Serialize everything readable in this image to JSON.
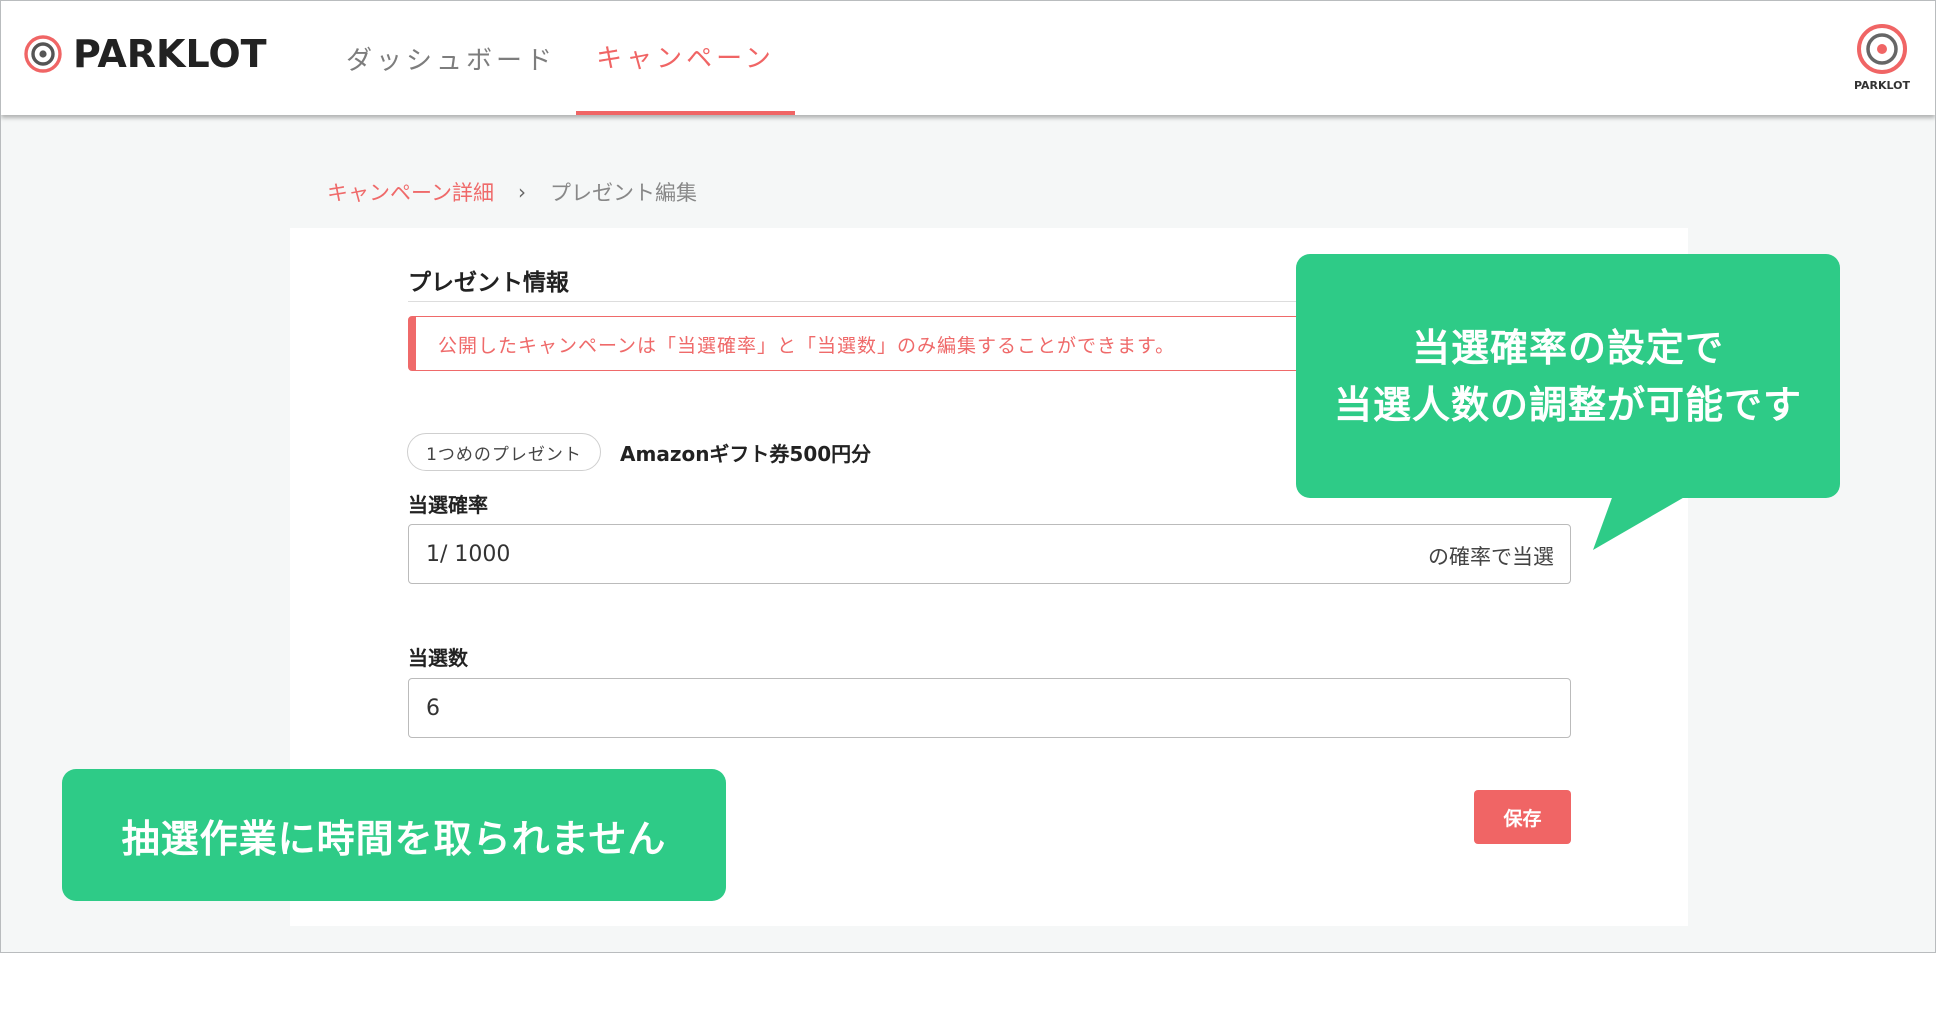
{
  "header": {
    "logo_text": "PARKLOT",
    "tabs": [
      {
        "label": "ダッシュボード",
        "active": false
      },
      {
        "label": "キャンペーン",
        "active": true
      }
    ],
    "avatar_label": "PARKLOT"
  },
  "breadcrumb": {
    "parent": "キャンペーン詳細",
    "separator": "›",
    "current": "プレゼント編集"
  },
  "form": {
    "section_title": "プレゼント情報",
    "alert": "公開したキャンペーンは「当選確率」と「当選数」のみ編集することができます。",
    "gift_chip": "1つめのプレゼント",
    "gift_name": "Amazonギフト券500円分",
    "probability": {
      "label": "当選確率",
      "value": "1/ 1000",
      "suffix": "の確率で当選"
    },
    "count": {
      "label": "当選数",
      "value": "6"
    },
    "save_label": "保存"
  },
  "callouts": {
    "right": [
      "当選確率の設定で",
      "当選人数の調整が可能です"
    ],
    "left": "抽選作業に時間を取られません"
  },
  "colors": {
    "accent": "#f06565",
    "callout": "#2ecb87",
    "background": "#f5f7f7"
  }
}
